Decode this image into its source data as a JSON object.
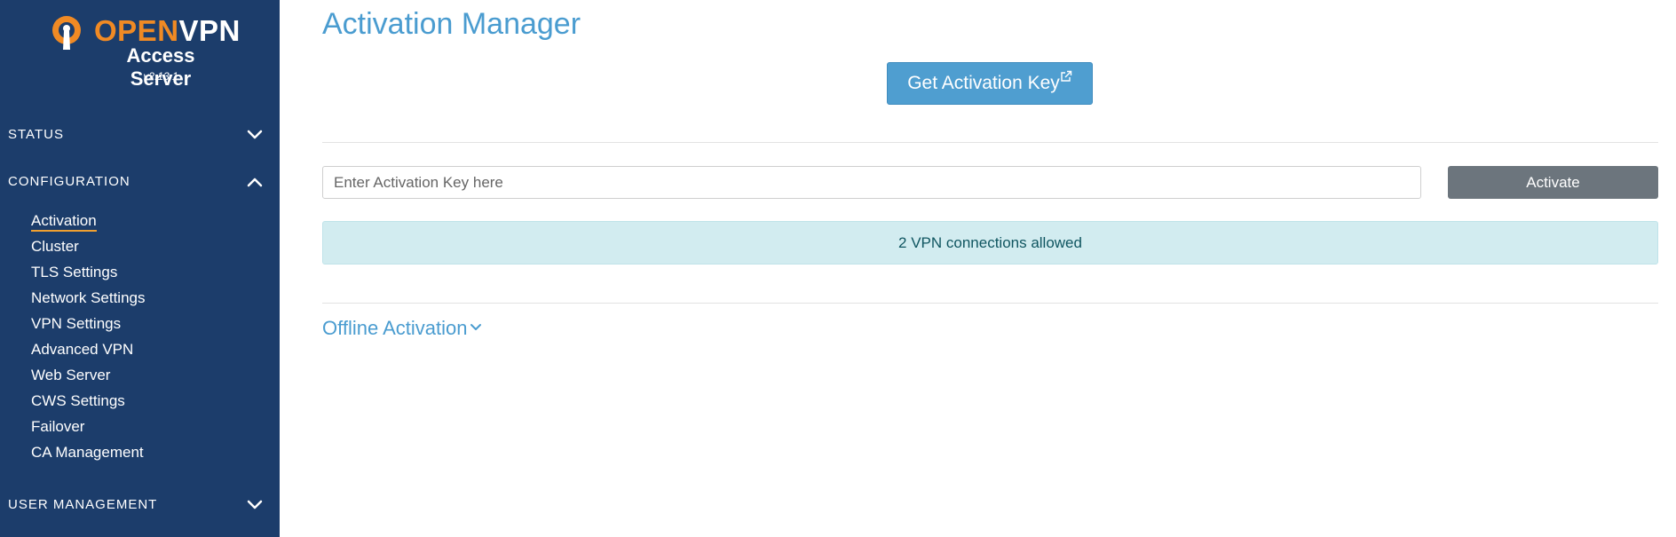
{
  "brand": {
    "logo_open": "OPEN",
    "logo_vpn": "VPN",
    "subtitle": "Access Server",
    "version": "v2.13.1",
    "color_orange": "#f08a24",
    "color_sidebar": "#1c3d6b"
  },
  "sidebar": {
    "sections": [
      {
        "label": "STATUS",
        "expanded": false,
        "icon": "chevron-down-icon"
      },
      {
        "label": "CONFIGURATION",
        "expanded": true,
        "icon": "chevron-up-icon"
      },
      {
        "label": "USER MANAGEMENT",
        "expanded": false,
        "icon": "chevron-down-icon"
      }
    ],
    "config_items": [
      {
        "label": "Activation",
        "active": true
      },
      {
        "label": "Cluster"
      },
      {
        "label": "TLS Settings"
      },
      {
        "label": "Network Settings"
      },
      {
        "label": "VPN Settings"
      },
      {
        "label": "Advanced VPN"
      },
      {
        "label": "Web Server"
      },
      {
        "label": "CWS Settings"
      },
      {
        "label": "Failover"
      },
      {
        "label": "CA Management"
      }
    ]
  },
  "main": {
    "title": "Activation Manager",
    "get_key_label": "Get Activation Key",
    "get_key_icon": "external-link-icon",
    "key_input": {
      "placeholder": "Enter Activation Key here",
      "value": ""
    },
    "activate_label": "Activate",
    "alert_text": "2 VPN connections allowed",
    "offline_label": "Offline Activation",
    "colors": {
      "accent": "#4a9cd0",
      "button_primary": "#4f9ed0",
      "button_secondary": "#6c757d",
      "alert_bg": "#d2ecf0",
      "alert_text": "#0f5560"
    }
  }
}
